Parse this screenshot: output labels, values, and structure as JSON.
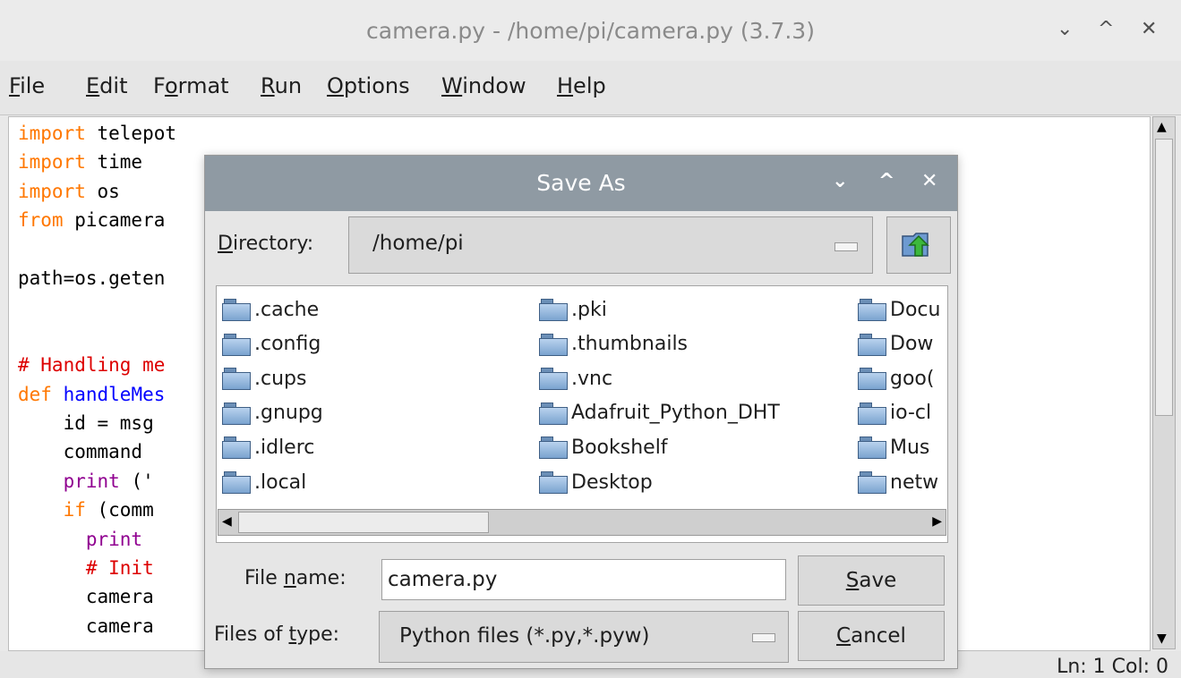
{
  "window": {
    "title": "camera.py - /home/pi/camera.py (3.7.3)",
    "controls": [
      "⌄",
      "^",
      "✕"
    ]
  },
  "menu": [
    {
      "pre": "",
      "u": "F",
      "post": "ile"
    },
    {
      "pre": "",
      "u": "E",
      "post": "dit"
    },
    {
      "pre": "F",
      "u": "o",
      "post": "rmat"
    },
    {
      "pre": "",
      "u": "R",
      "post": "un"
    },
    {
      "pre": "",
      "u": "O",
      "post": "ptions"
    },
    {
      "pre": "",
      "u": "W",
      "post": "indow"
    },
    {
      "pre": "",
      "u": "H",
      "post": "elp"
    }
  ],
  "code": [
    {
      "kw": "import",
      "rest": " telepot"
    },
    {
      "kw": "import",
      "rest": " time"
    },
    {
      "kw": "import",
      "rest": " os"
    },
    {
      "kw": "from",
      "rest": " picamera"
    },
    {
      "rest": ""
    },
    {
      "rest": "path=os.geten"
    },
    {
      "rest": ""
    },
    {
      "rest": ""
    },
    {
      "cm": "# Handling me"
    },
    {
      "kw": "def",
      "fn": " handleMes"
    },
    {
      "rest": "    id = msg"
    },
    {
      "rest": "    command"
    },
    {
      "bi": "    print",
      "rest": " ('"
    },
    {
      "kw": "    if",
      "rest": " (comm"
    },
    {
      "bi": "      print"
    },
    {
      "cm": "      # Init"
    },
    {
      "rest": "      camera"
    },
    {
      "rest": "      camera"
    }
  ],
  "status": {
    "position": "Ln: 1  Col: 0"
  },
  "dialog": {
    "title": "Save As",
    "controls": [
      "⌄",
      "^",
      "✕"
    ],
    "directory_label": {
      "pre": "",
      "u": "D",
      "post": "irectory:"
    },
    "directory_value": "/home/pi",
    "files": [
      [
        ".cache",
        ".config",
        ".cups",
        ".gnupg",
        ".idlerc",
        ".local"
      ],
      [
        ".pki",
        ".thumbnails",
        ".vnc",
        "Adafruit_Python_DHT",
        "Bookshelf",
        "Desktop"
      ],
      [
        "Docu",
        "Dow",
        "goo(",
        "io-cl",
        "Mus",
        "netw"
      ]
    ],
    "file_name_label": {
      "pre": "File ",
      "u": "n",
      "post": "ame:"
    },
    "file_name_value": "camera.py",
    "file_type_label": {
      "pre": "Files of ",
      "u": "t",
      "post": "ype:"
    },
    "file_type_value": "Python files (*.py,*.pyw)",
    "save_button": {
      "pre": "",
      "u": "S",
      "post": "ave"
    },
    "cancel_button": {
      "pre": "",
      "u": "C",
      "post": "ancel"
    }
  }
}
